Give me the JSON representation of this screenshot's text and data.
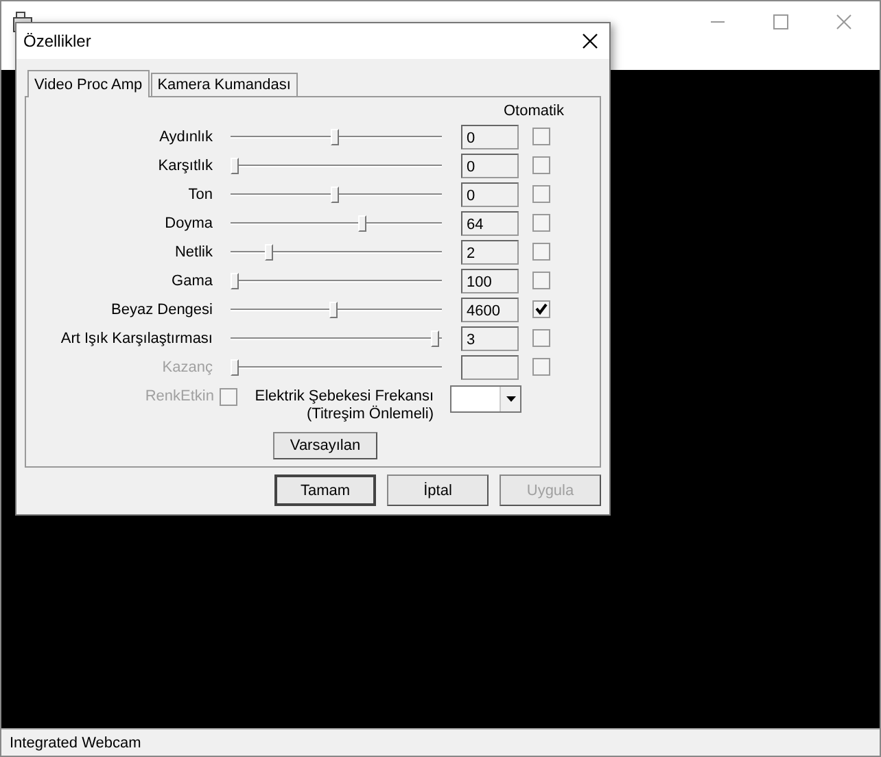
{
  "main_window": {
    "status_bar": "Integrated Webcam"
  },
  "dialog": {
    "title": "Özellikler",
    "tabs": [
      {
        "label": "Video Proc Amp",
        "selected": true
      },
      {
        "label": "Kamera Kumandası",
        "selected": false
      }
    ],
    "auto_header": "Otomatik",
    "properties": [
      {
        "label": "Aydınlık",
        "level": 0.5,
        "value": "0",
        "auto": false,
        "disabled": false
      },
      {
        "label": "Karşıtlık",
        "level": 0,
        "value": "0",
        "auto": false,
        "disabled": false
      },
      {
        "label": "Ton",
        "level": 0.5,
        "value": "0",
        "auto": false,
        "disabled": false
      },
      {
        "label": "Doyma",
        "level": 0.64,
        "value": "64",
        "auto": false,
        "disabled": false
      },
      {
        "label": "Netlik",
        "level": 0.17,
        "value": "2",
        "auto": false,
        "disabled": false
      },
      {
        "label": "Gama",
        "level": 0,
        "value": "100",
        "auto": false,
        "disabled": false
      },
      {
        "label": "Beyaz Dengesi",
        "level": 0.49,
        "value": "4600",
        "auto": true,
        "disabled": false
      },
      {
        "label": "Art Işık Karşılaştırması",
        "level": 1,
        "value": "3",
        "auto": false,
        "disabled": false
      },
      {
        "label": "Kazanç",
        "level": 0,
        "auto": false,
        "disabled": true
      }
    ],
    "color_enable": {
      "label": "RenkEtkin",
      "checked": false,
      "disabled": true
    },
    "power_line": {
      "label": "Elektrik Şebekesi Frekansı",
      "sublabel": "(Titreşim Önlemeli)"
    },
    "defaults_button": "Varsayılan",
    "buttons": [
      {
        "label": "Tamam",
        "disabled": false,
        "default": true
      },
      {
        "label": "İptal",
        "disabled": false,
        "default": false
      },
      {
        "label": "Uygula",
        "disabled": true,
        "default": false
      }
    ]
  }
}
